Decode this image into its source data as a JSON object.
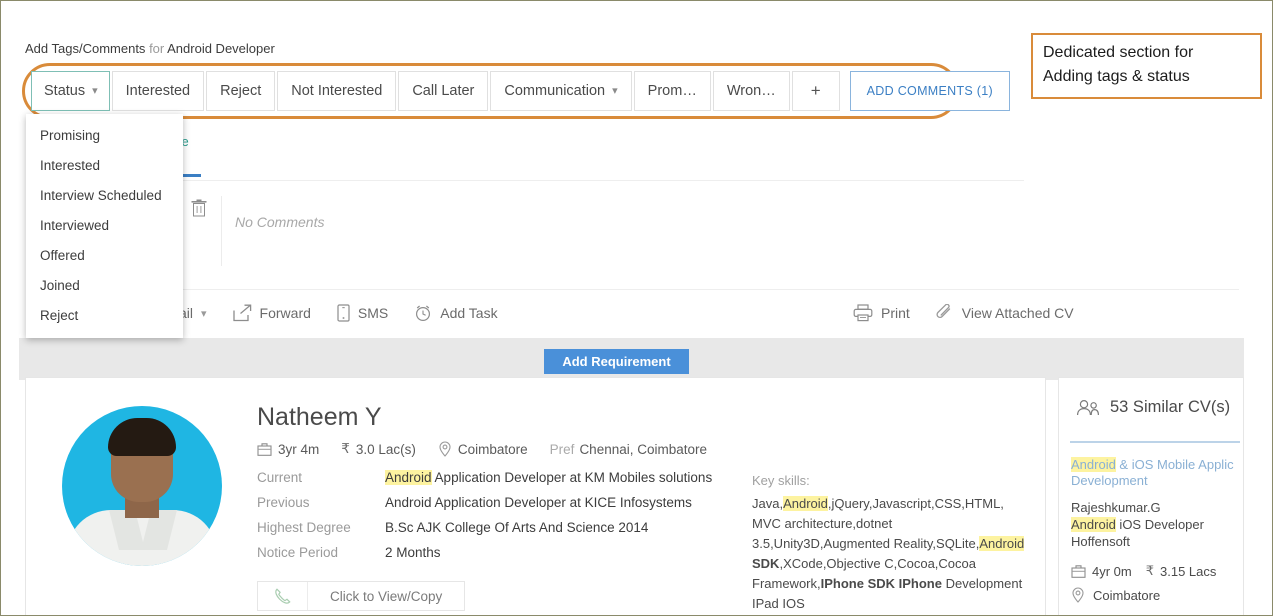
{
  "tags_panel": {
    "header_prefix": "Add Tags/Comments",
    "header_for": "for",
    "header_role": "Android Developer",
    "status_button": "Status",
    "buttons": [
      {
        "label": "Interested"
      },
      {
        "label": "Reject"
      },
      {
        "label": "Not Interested"
      },
      {
        "label": "Call Later"
      },
      {
        "label": "Communication",
        "has_caret": true
      },
      {
        "label": "Prom…"
      },
      {
        "label": "Wron…"
      }
    ],
    "add_tag_label": "+",
    "add_comments_label": "ADD COMMENTS (1)",
    "callout_color": "#d98b3a",
    "status_border_color": "#7fbfb5",
    "add_comments_color": "#3b7fc4"
  },
  "status_dropdown": {
    "items": [
      "Promising",
      "Interested",
      "Interview Scheduled",
      "Interviewed",
      "Offered",
      "Joined",
      "Reject"
    ]
  },
  "background": {
    "active_fragment": "ve",
    "no_comments": "No Comments"
  },
  "toolbar": {
    "mail_fragment": "ail",
    "forward": "Forward",
    "sms": "SMS",
    "add_task": "Add Task",
    "print": "Print",
    "view_cv": "View Attached CV"
  },
  "band": {
    "add_requirement": "Add Requirement",
    "add_requirement_color": "#4a90d9"
  },
  "candidate": {
    "name": "Natheem Y",
    "experience": "3yr 4m",
    "salary_symbol": "₹",
    "salary": "3.0 Lac(s)",
    "location": "Coimbatore",
    "pref_label": "Pref",
    "pref_locations": "Chennai, Coimbatore",
    "details": [
      {
        "label": "Current",
        "highlight": "Android",
        "value": " Application Developer at KM Mobiles solutions"
      },
      {
        "label": "Previous",
        "highlight": "",
        "value": "Android Application Developer at KICE Infosystems"
      },
      {
        "label": "Highest Degree",
        "highlight": "",
        "value": "B.Sc AJK College Of Arts And Science 2014"
      },
      {
        "label": "Notice Period",
        "highlight": "",
        "value": "2 Months"
      }
    ],
    "phone_button": "Click to View/Copy",
    "skills_label": "Key skills:",
    "skills_parts": [
      {
        "text": "Java,",
        "style": "normal"
      },
      {
        "text": "Android",
        "style": "highlight"
      },
      {
        "text": ",jQuery,Javascript,CSS,HTML, MVC architecture,dotnet 3.5,Unity3D,Augmented Reality,SQLite,",
        "style": "normal"
      },
      {
        "text": "Android",
        "style": "highlight"
      },
      {
        "text": " SDK",
        "style": "bold"
      },
      {
        "text": ",XCode,Objective C,Cocoa,Cocoa Framework,",
        "style": "normal"
      },
      {
        "text": "IPhone SDK IPhone",
        "style": "bold"
      },
      {
        "text": " Development IPad IOS",
        "style": "normal"
      }
    ]
  },
  "similar": {
    "count_label": "53 Similar CV(s)",
    "job_title_highlight": "Android",
    "job_title_rest": " & iOS Mobile Applic Development",
    "candidate_name": "Rajeshkumar.G",
    "role_highlight": "Android",
    "role_rest": " iOS Developer",
    "company": "Hoffensoft",
    "experience": "4yr 0m",
    "salary_symbol": "₹",
    "salary": "3.15 Lacs",
    "location": "Coimbatore"
  },
  "annotation": {
    "line1": "Dedicated section for",
    "line2": "Adding tags & status",
    "border_color": "#d98b3a"
  },
  "colors": {
    "highlight_yellow": "#fdf3a0",
    "accent_blue": "#3b7fc4",
    "band_gray": "#e8e8e8",
    "avatar_bg": "#1fb6e3"
  }
}
